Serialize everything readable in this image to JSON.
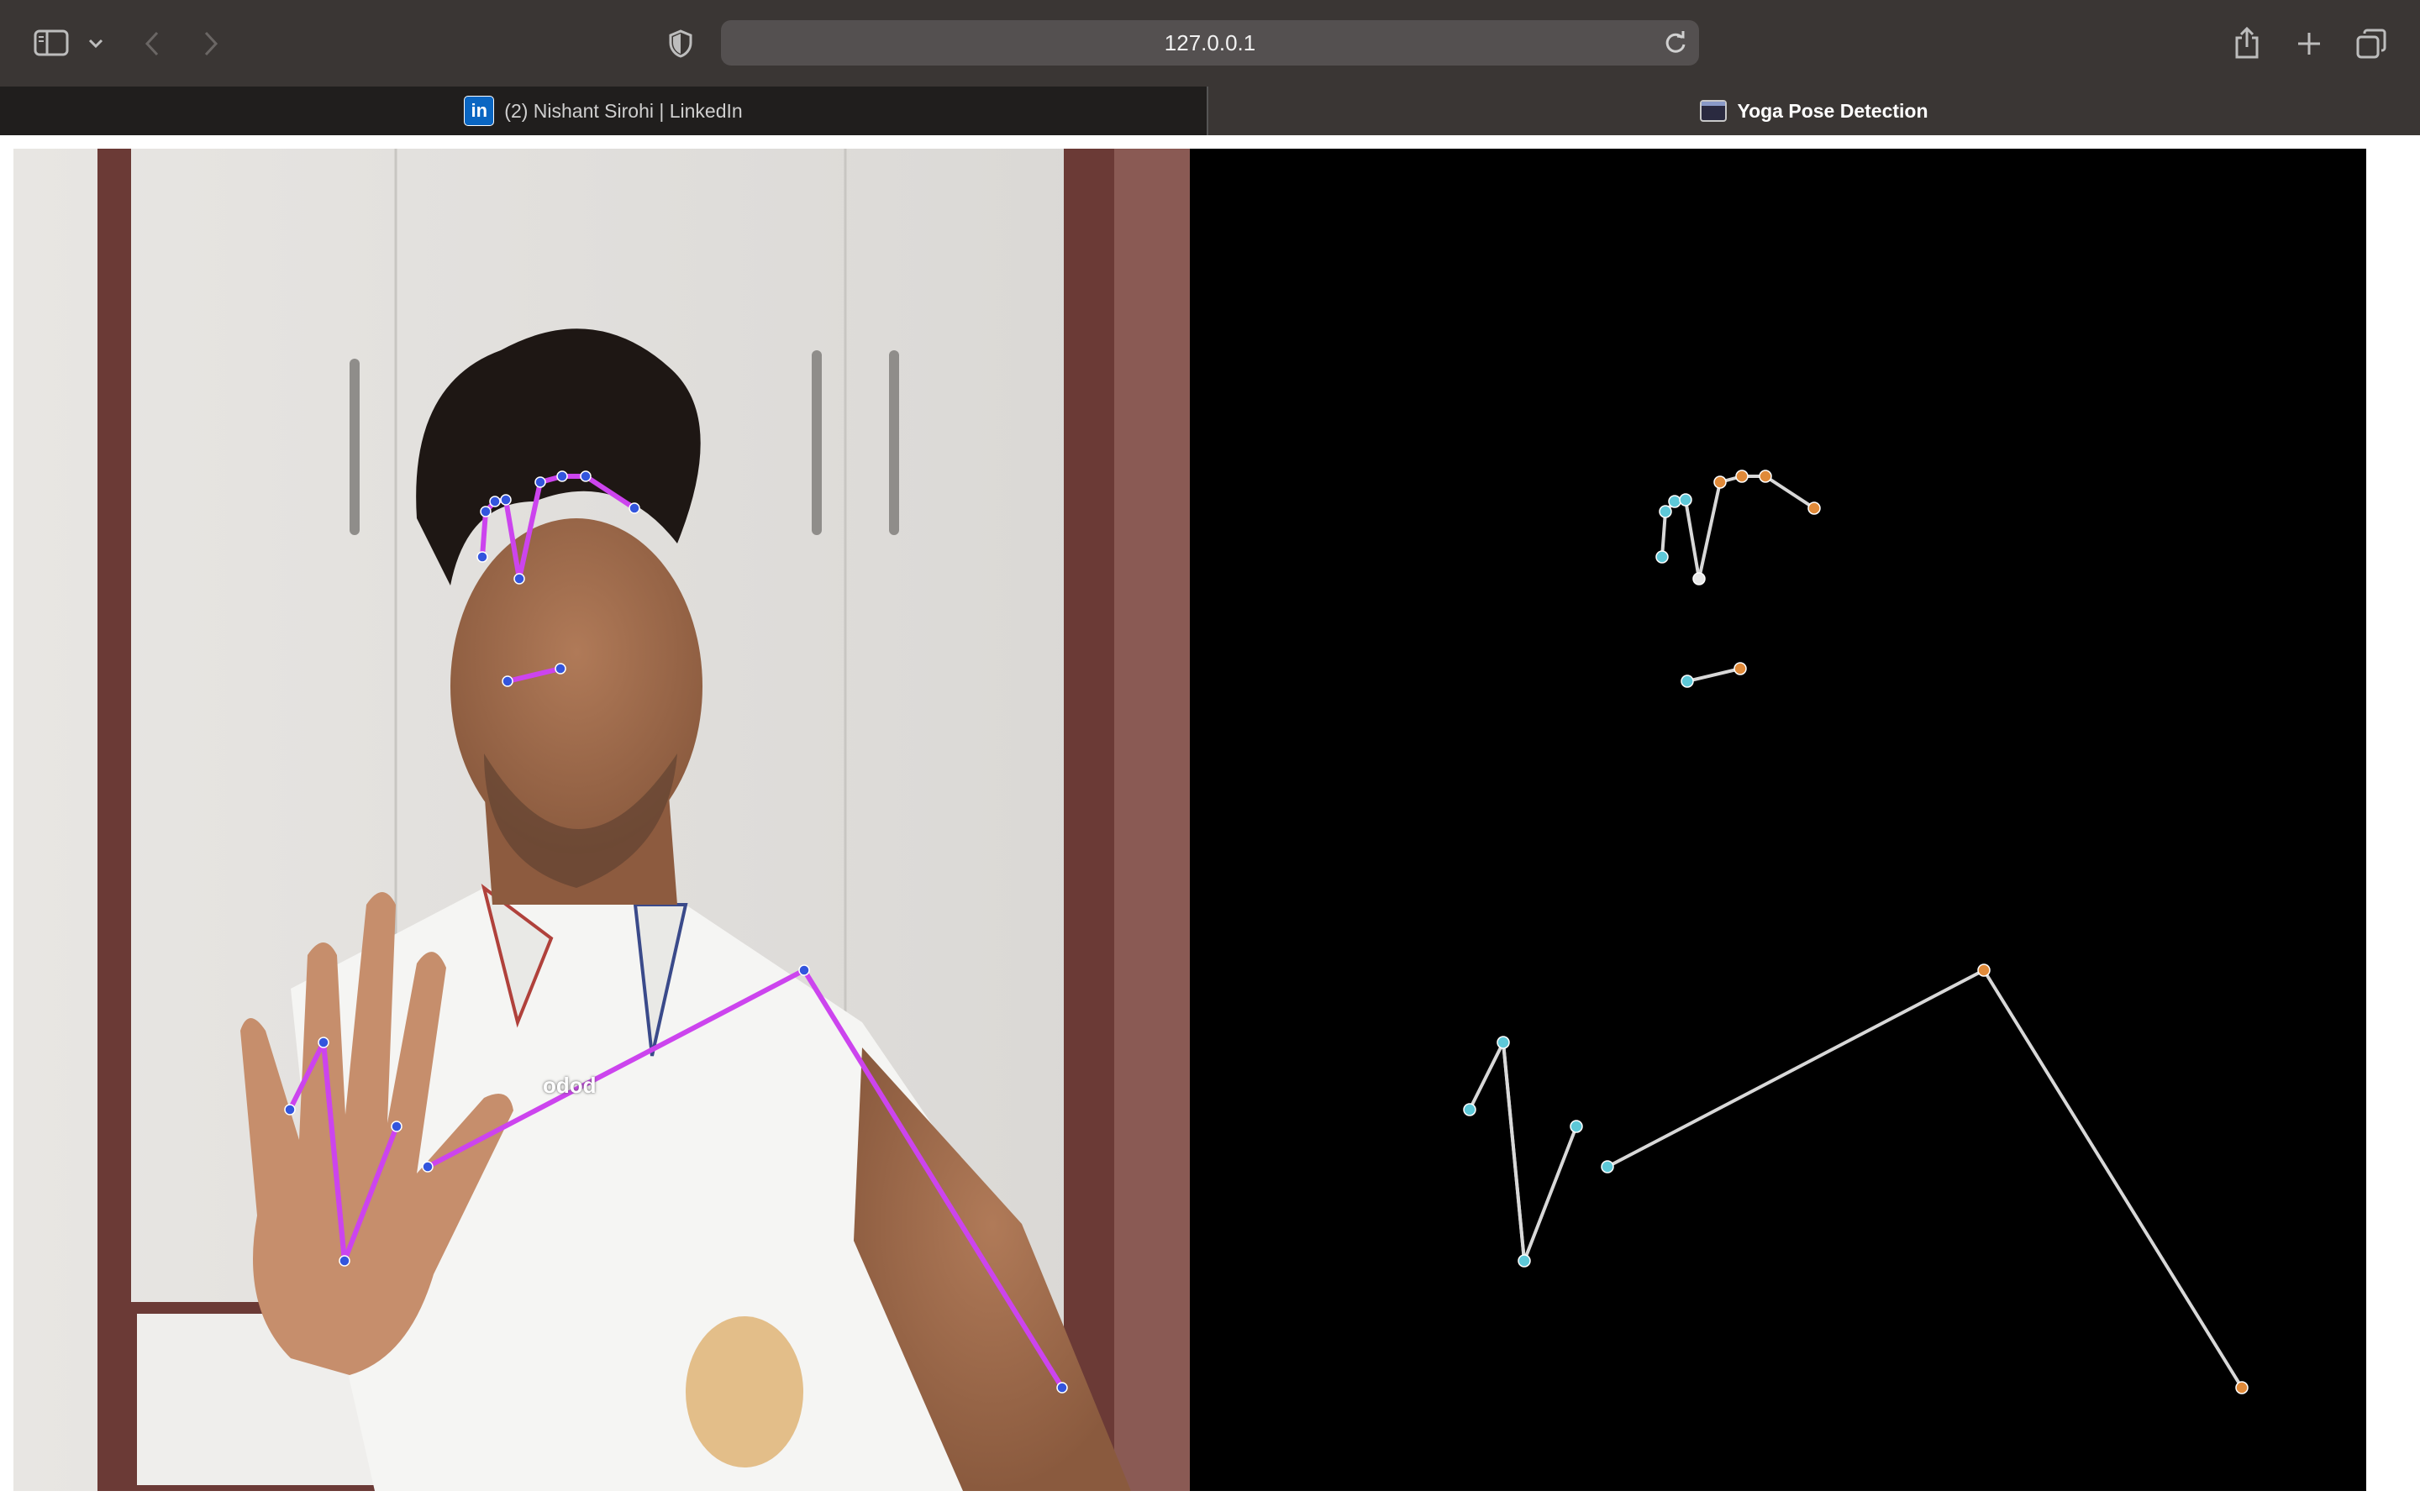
{
  "browser": {
    "url": "127.0.0.1",
    "tabs": [
      {
        "label": "(2) Nishant Sirohi | LinkedIn",
        "favicon": "linkedin-icon",
        "active": false
      },
      {
        "label": "Yoga Pose Detection",
        "favicon": "terminal-icon",
        "active": true
      }
    ],
    "toolbar_icons": [
      "sidebar-icon",
      "chevron-down-icon",
      "back-icon",
      "forward-icon",
      "privacy-shield-icon",
      "reload-icon",
      "share-icon",
      "new-tab-icon",
      "tab-overview-icon"
    ]
  },
  "app": {
    "camera_overlay_text": "odod"
  },
  "colors": {
    "toolbar": "#3a3634",
    "skeleton_camera": "#cc44ee",
    "joint_camera": "#3355dd",
    "skeleton_canvas": "#d8d8d8",
    "joint_left": "#5ec8d8",
    "joint_right": "#e08a3a"
  }
}
